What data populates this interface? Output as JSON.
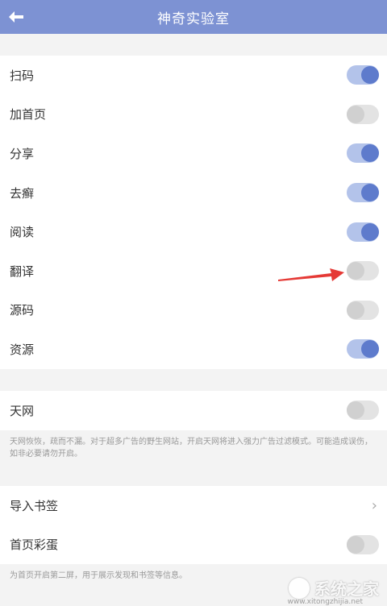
{
  "header": {
    "title": "神奇实验室",
    "back_icon": "back-arrow-icon"
  },
  "colors": {
    "header_bg": "#7d92d3",
    "toggle_on_track": "#b3c3ea",
    "toggle_on_knob": "#5e7bcc",
    "toggle_off_track": "#e3e3e3",
    "toggle_off_knob": "#d0d0d0",
    "annotation_arrow": "#e53935"
  },
  "section1": {
    "items": [
      {
        "label": "扫码",
        "on": true
      },
      {
        "label": "加首页",
        "on": false
      },
      {
        "label": "分享",
        "on": true
      },
      {
        "label": "去癣",
        "on": true
      },
      {
        "label": "阅读",
        "on": true
      },
      {
        "label": "翻译",
        "on": false
      },
      {
        "label": "源码",
        "on": false
      },
      {
        "label": "资源",
        "on": true
      }
    ]
  },
  "section2": {
    "item": {
      "label": "天网",
      "on": false
    },
    "description": "天网恢恢，疏而不漏。对于超多广告的野生网站，开启天网将进入强力广告过滤模式。可能造成误伤，如非必要请勿开启。"
  },
  "section3": {
    "import_bookmarks": {
      "label": "导入书签"
    },
    "easter_egg": {
      "label": "首页彩蛋",
      "on": false
    },
    "description": "为首页开启第二屏，用于展示发现和书签等信息。"
  },
  "watermark": {
    "text": "系统之家",
    "url": "www.xitongzhijia.net"
  }
}
